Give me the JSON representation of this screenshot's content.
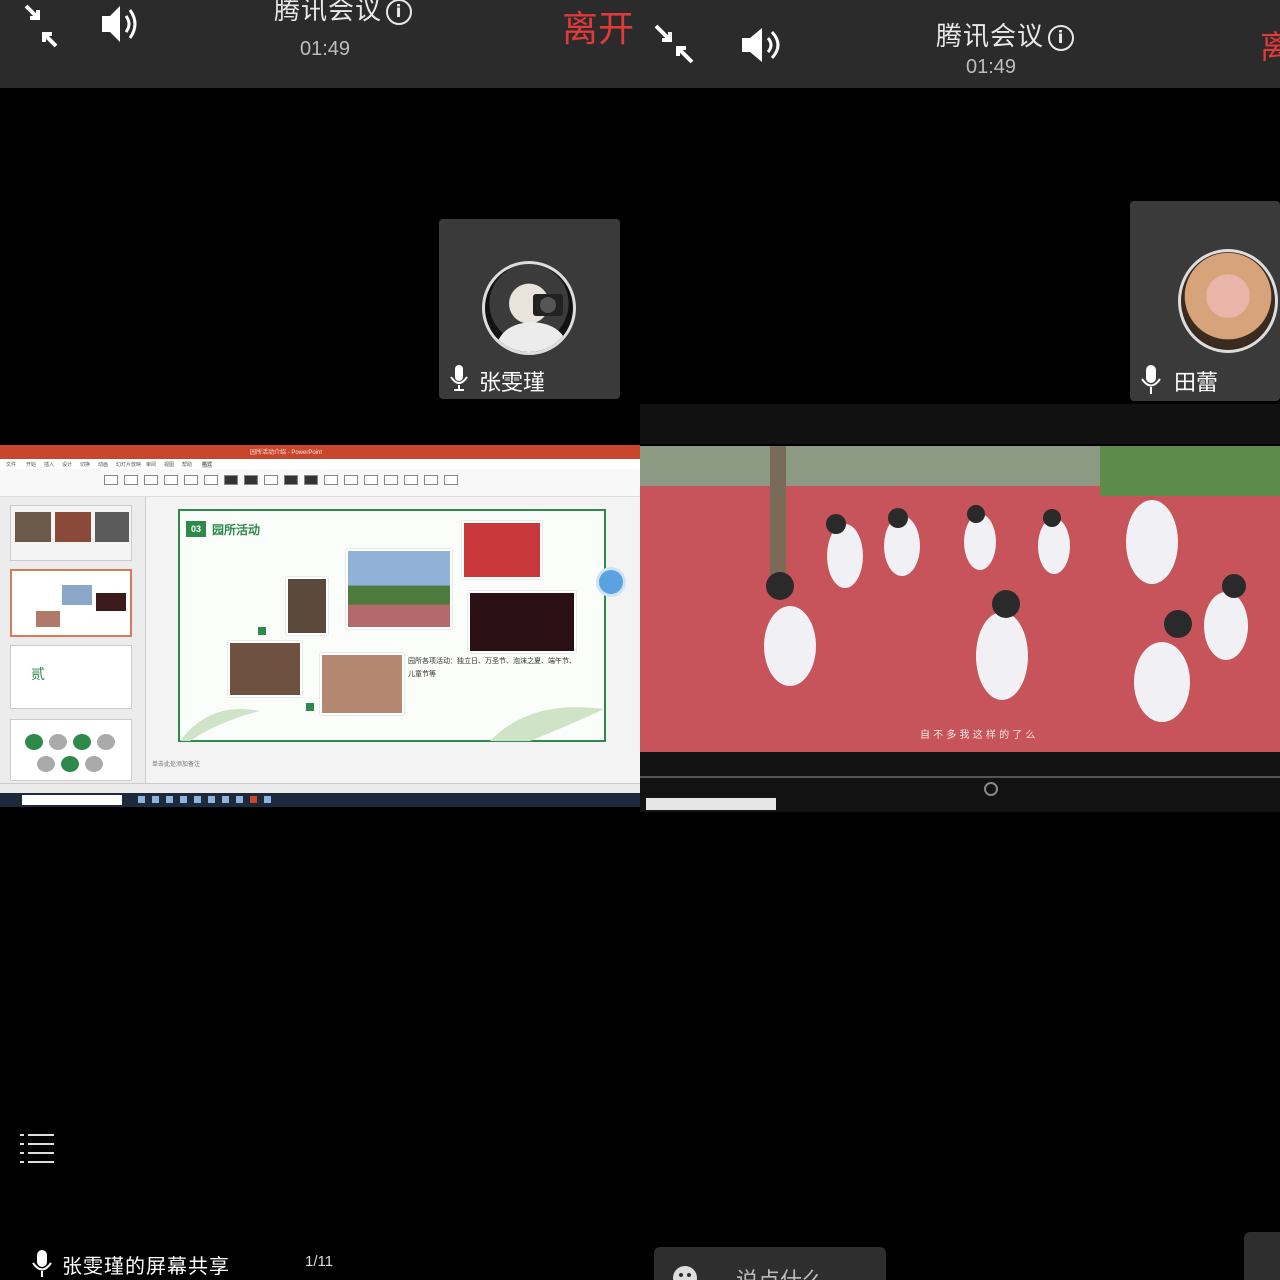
{
  "left_pane": {
    "app_title": "腾讯会议",
    "timer": "01:49",
    "leave_label": "离开",
    "participant": {
      "name": "张雯瑾"
    },
    "screen_share": {
      "window_title": "园所活动介绍 - PowerPoint",
      "menu_items": [
        "文件",
        "开始",
        "插入",
        "设计",
        "切换",
        "动画",
        "幻灯片放映",
        "审阅",
        "视图",
        "帮助",
        "格式"
      ],
      "slide": {
        "number": "03",
        "title": "园所活动",
        "caption": "园所各项活动：独立日、万圣节、泡沫之夏、端午节、儿童节等"
      },
      "thumb_number": "贰",
      "notes_placeholder": "单击此处添加备注"
    },
    "share_label": "张雯瑾的屏幕共享",
    "page_count": "1/11"
  },
  "right_pane": {
    "app_title": "腾讯会议",
    "timer": "01:49",
    "leave_label": "离",
    "participant": {
      "name": "田蕾"
    },
    "video": {
      "subtitle": "自 不 多 我 这 样 的 了 么"
    },
    "chat_placeholder": "说点什么"
  },
  "colors": {
    "topbar": "#2b2b2b",
    "leave_red": "#e03a3a",
    "ppt_accent": "#c7462c",
    "slide_green": "#2d8a4a",
    "floor_red": "#c7545a"
  },
  "icons": [
    "exit-fullscreen-icon",
    "speaker-icon",
    "info-icon",
    "mic-icon",
    "menu-icon",
    "smile-icon"
  ]
}
